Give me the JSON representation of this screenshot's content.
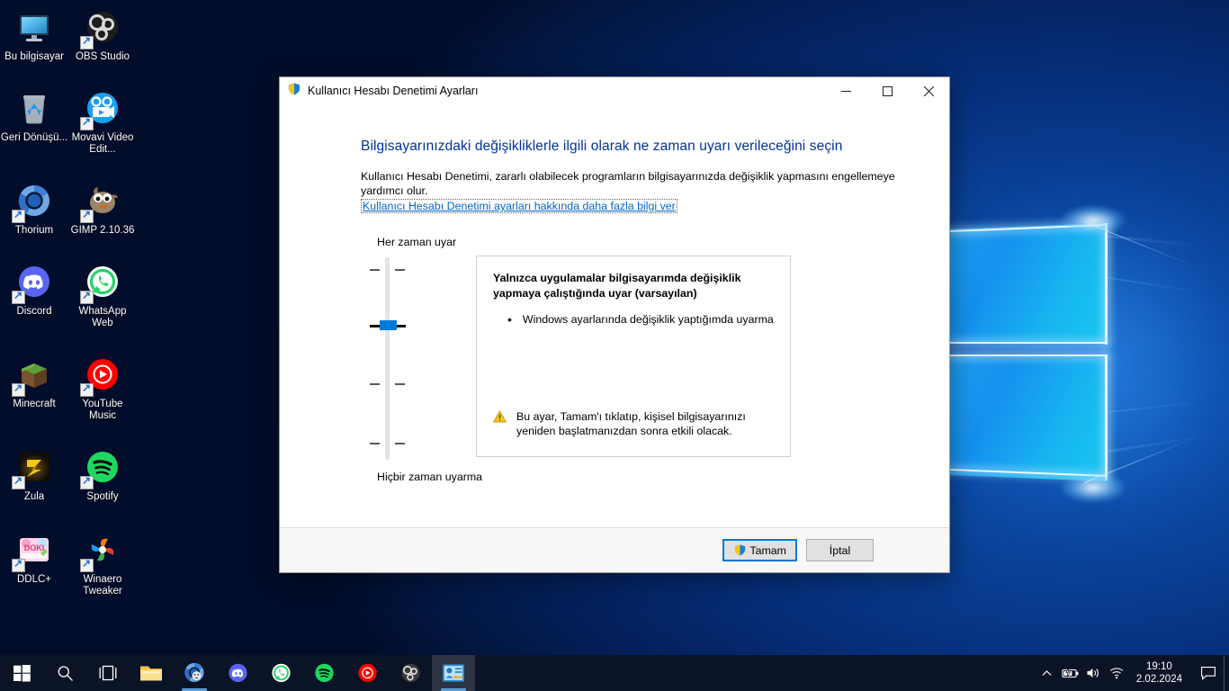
{
  "desktop": {
    "icons": [
      {
        "label": "Bu bilgisayar",
        "icon": "this-pc-icon",
        "shortcut": false
      },
      {
        "label": "OBS Studio",
        "icon": "obs-studio-icon",
        "shortcut": true
      },
      {
        "label": "Geri Dönüşü...",
        "icon": "recycle-bin-icon",
        "shortcut": false
      },
      {
        "label": "Movavi Video Edit...",
        "icon": "movavi-video-editor-icon",
        "shortcut": true
      },
      {
        "label": "Thorium",
        "icon": "thorium-browser-icon",
        "shortcut": true
      },
      {
        "label": "GIMP 2.10.36",
        "icon": "gimp-icon",
        "shortcut": true
      },
      {
        "label": "Discord",
        "icon": "discord-icon",
        "shortcut": true
      },
      {
        "label": "WhatsApp Web",
        "icon": "whatsapp-icon",
        "shortcut": true
      },
      {
        "label": "Minecraft",
        "icon": "minecraft-icon",
        "shortcut": true
      },
      {
        "label": "YouTube Music",
        "icon": "youtube-music-icon",
        "shortcut": true
      },
      {
        "label": "Zula",
        "icon": "zula-game-icon",
        "shortcut": true
      },
      {
        "label": "Spotify",
        "icon": "spotify-icon",
        "shortcut": true
      },
      {
        "label": "DDLC+",
        "icon": "ddlc-plus-icon",
        "shortcut": true
      },
      {
        "label": "Winaero Tweaker",
        "icon": "winaero-tweaker-icon",
        "shortcut": true
      }
    ]
  },
  "dialog": {
    "title": "Kullanıcı Hesabı Denetimi Ayarları",
    "title_icon": "uac-shield-icon",
    "window_controls": {
      "minimize": "—",
      "maximize": "☐",
      "close": "✕"
    },
    "heading": "Bilgisayarınızdaki değişikliklerle ilgili olarak ne zaman uyarı verileceğini seçin",
    "subtext": "Kullanıcı Hesabı Denetimi, zararlı olabilecek programların bilgisayarınızda değişiklik yapmasını engellemeye yardımcı olur.",
    "link": "Kullanıcı Hesabı Denetimi ayarları hakkında daha fazla bilgi ver",
    "slider": {
      "top_label": "Her zaman uyar",
      "bottom_label": "Hiçbir zaman uyarma",
      "levels": 4,
      "selected_index": 1,
      "thumb_color": "#0078d7"
    },
    "description": {
      "title": "Yalnızca uygulamalar bilgisayarımda değişiklik yapmaya çalıştığında uyar (varsayılan)",
      "bullets": [
        "Windows ayarlarında değişiklik yaptığımda uyarma"
      ],
      "note_icon": "warning-triangle-icon",
      "note": "Bu ayar, Tamam'ı tıklatıp, kişisel bilgisayarınızı yeniden başlatmanızdan sonra etkili olacak."
    },
    "buttons": {
      "ok": "Tamam",
      "ok_icon": "uac-shield-icon",
      "cancel": "İptal"
    },
    "accent_color": "#0078d7",
    "heading_color": "#003399",
    "link_color": "#0066cc"
  },
  "taskbar": {
    "start": "start-button",
    "items": [
      {
        "name": "search-icon",
        "running": false
      },
      {
        "name": "task-view-icon",
        "running": false
      },
      {
        "name": "file-explorer-icon",
        "running": false
      },
      {
        "name": "thorium-browser-icon",
        "running": true
      },
      {
        "name": "discord-icon",
        "running": false
      },
      {
        "name": "whatsapp-icon",
        "running": false
      },
      {
        "name": "spotify-icon",
        "running": false
      },
      {
        "name": "youtube-music-icon",
        "running": false
      },
      {
        "name": "obs-studio-icon",
        "running": false
      },
      {
        "name": "uac-settings-icon",
        "running": true,
        "active": true
      }
    ],
    "tray": {
      "chevron": "show-hidden-icons-chevron",
      "battery": "battery-charging-icon",
      "volume": "volume-icon",
      "network": "wifi-icon",
      "time": "19:10",
      "date": "2.02.2024",
      "action_center": "action-center-icon"
    }
  }
}
